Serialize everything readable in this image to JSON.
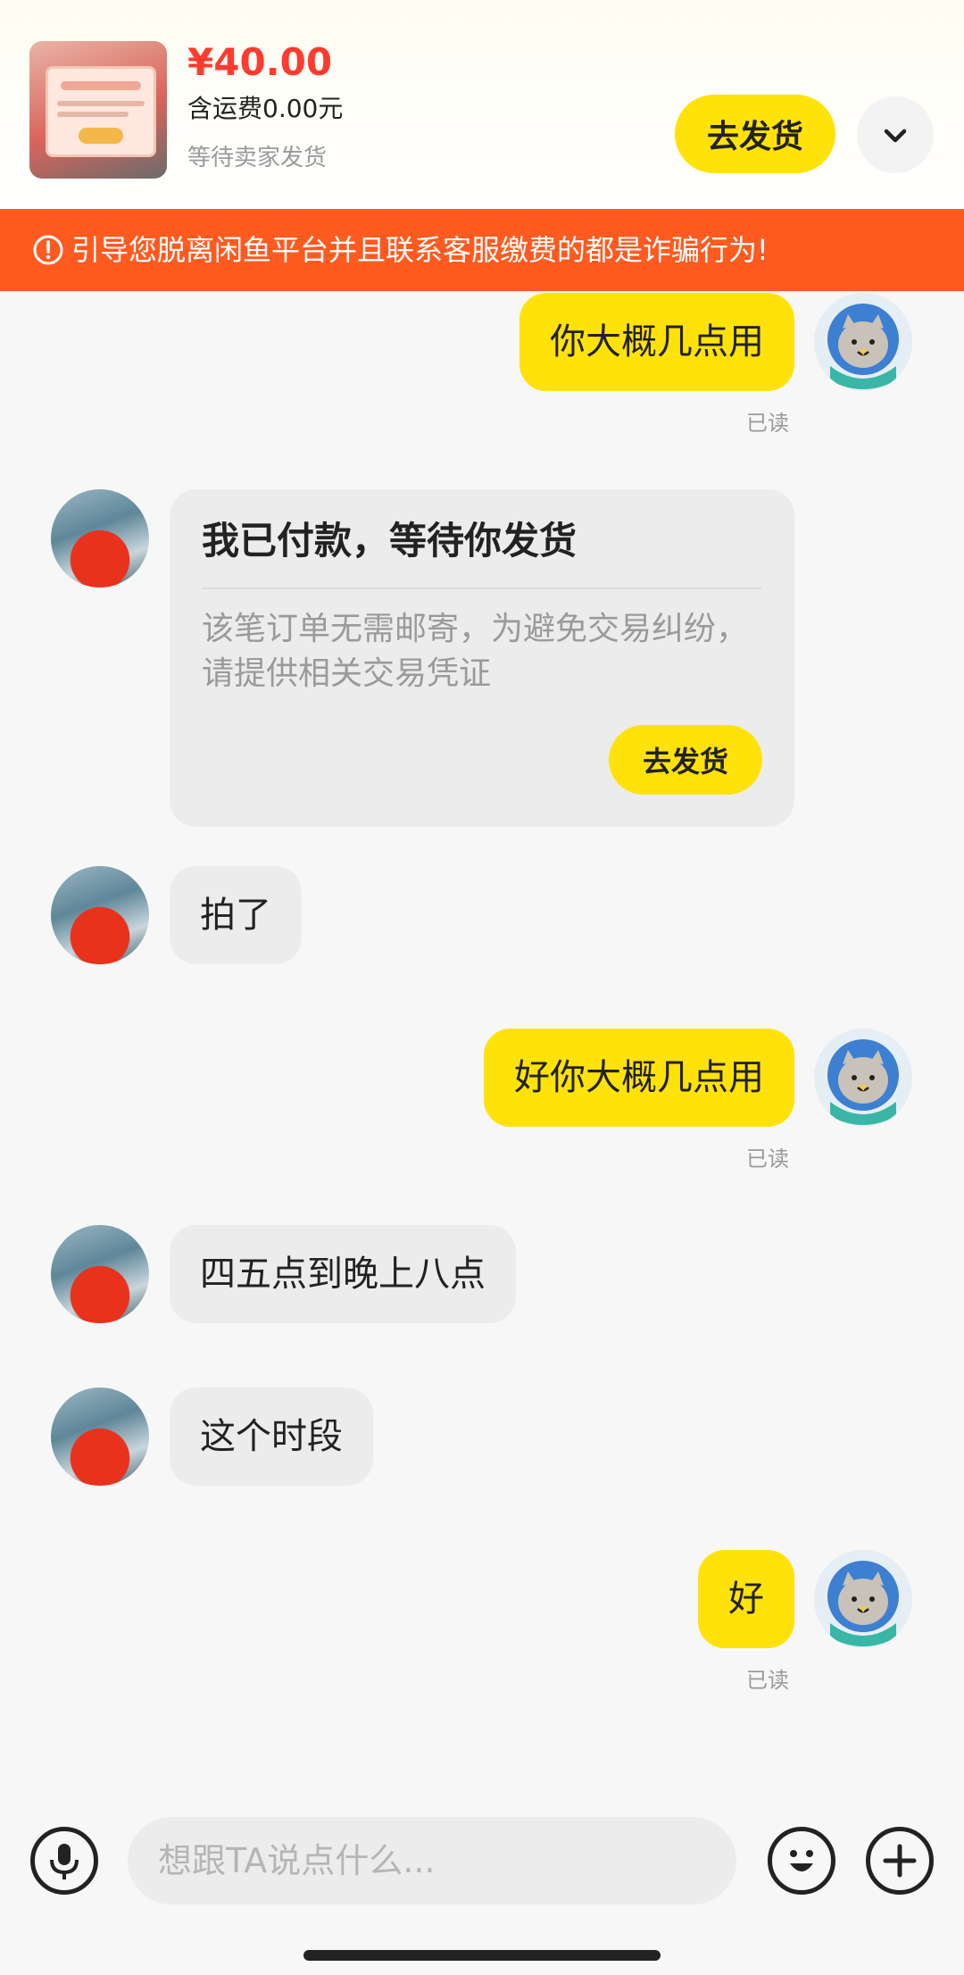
{
  "order": {
    "price": "¥40.00",
    "shipping": "含运费0.00元",
    "status": "等待卖家发货",
    "action_label": "去发货"
  },
  "warning": {
    "text": "引导您脱离闲鱼平台并且联系客服缴费的都是诈骗行为!"
  },
  "messages": [
    {
      "from": "me",
      "text": "你大概几点用",
      "read": "已读"
    },
    {
      "from": "other",
      "type": "card",
      "title": "我已付款，等待你发货",
      "body": "该笔订单无需邮寄，为避免交易纠纷，请提供相关交易凭证",
      "button": "去发货"
    },
    {
      "from": "other",
      "text": "拍了"
    },
    {
      "from": "me",
      "text": "好你大概几点用",
      "read": "已读"
    },
    {
      "from": "other",
      "text": "四五点到晚上八点"
    },
    {
      "from": "other",
      "text": "这个时段"
    },
    {
      "from": "me",
      "text": "好",
      "read": "已读"
    }
  ],
  "input": {
    "placeholder": "想跟TA说点什么..."
  },
  "colors": {
    "accent_yellow": "#ffe20a",
    "warning_orange": "#ff5a1f",
    "price_red": "#ff3b2f"
  },
  "icons": [
    "chevron-down-icon",
    "alert-circle-icon",
    "microphone-icon",
    "emoji-icon",
    "plus-icon"
  ]
}
